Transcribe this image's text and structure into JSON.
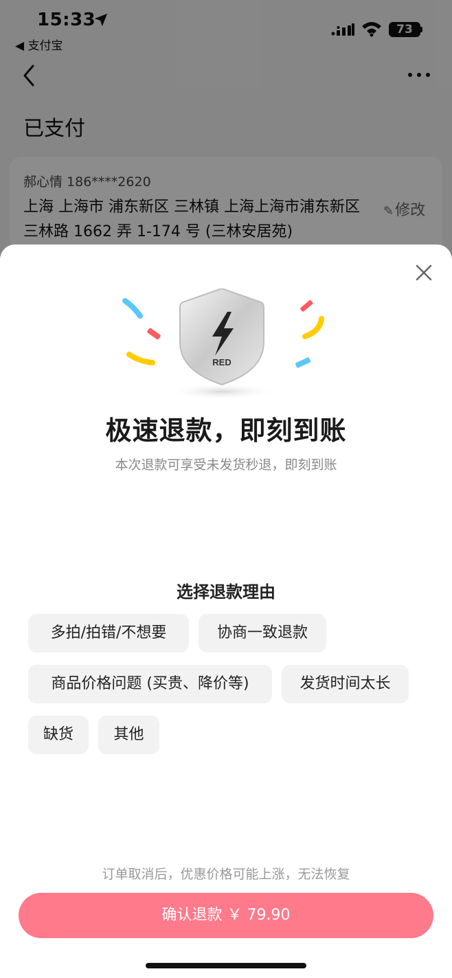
{
  "status_bar": {
    "time": "15:33",
    "back_app": "◀ 支付宝",
    "battery": "73"
  },
  "header": {
    "title": "已支付"
  },
  "address": {
    "name_phone": "郝心情 186****2620",
    "line": "上海 上海市 浦东新区 三林镇 上海上海市浦东新区三林路 1662 弄 1-174 号 (三林安居苑)",
    "edit_label": "修改"
  },
  "sheet": {
    "badge_text": "RED",
    "headline": "极速退款，即刻到账",
    "subline": "本次退款可享受未发货秒退，即刻到账",
    "reason_title": "选择退款理由",
    "reasons": [
      "多拍/拍错/不想要",
      "协商一致退款",
      "商品价格问题 (买贵、降价等)",
      "发货时间太长",
      "缺货",
      "其他"
    ],
    "note": "订单取消后，优惠价格可能上涨，无法恢复",
    "confirm_label": "确认退款 ￥ 79.90"
  },
  "colors": {
    "confirm_button": "#ff7a8b",
    "chip_bg": "#f2f2f2",
    "confetti": [
      "#5ac8fa",
      "#ff5a5f",
      "#ffcc00"
    ]
  },
  "icons": [
    "location-arrow-icon",
    "signal-icon",
    "wifi-icon",
    "battery-icon",
    "back-chevron-icon",
    "more-icon",
    "edit-pen-icon",
    "close-icon",
    "shield-lightning-icon"
  ]
}
